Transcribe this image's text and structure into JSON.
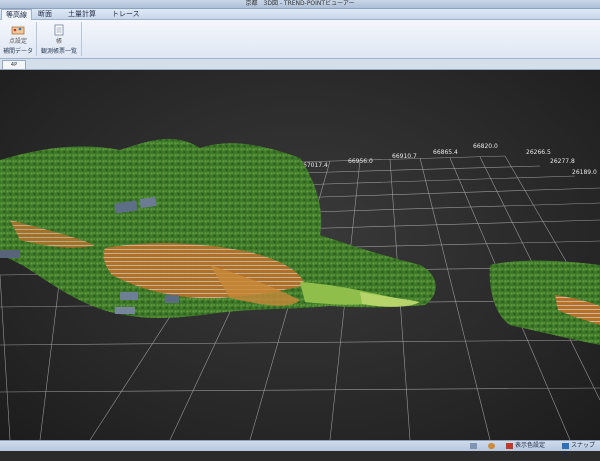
{
  "window": {
    "title": "京都　3D図 - TREND-POINTビューアー"
  },
  "ribbon": {
    "tabs": [
      {
        "label": "等高線"
      },
      {
        "label": "断面"
      },
      {
        "label": "土量計算"
      },
      {
        "label": "トレース"
      }
    ],
    "groups": [
      {
        "label": "補間データ",
        "button_label": "点設定"
      },
      {
        "label": "観測帳票一覧",
        "button_label": "帳"
      }
    ]
  },
  "doc_tab": {
    "label": "4P"
  },
  "viewport": {
    "coordinate_labels": [
      "67017.4",
      "66956.0",
      "66910.7",
      "66865.4",
      "66820.0",
      "26266.5",
      "26277.8",
      "26189.0"
    ]
  },
  "statusbar": {
    "display_settings": "表示色設定",
    "snap_settings": "スナップ設"
  },
  "colors": {
    "ribbon_bg": "#e6edf7",
    "viewport_bg": "#2b2b2b",
    "grid_line": "#bfbfbf",
    "vegetation": "#3f7a2a",
    "terrace": "#b5702a"
  }
}
